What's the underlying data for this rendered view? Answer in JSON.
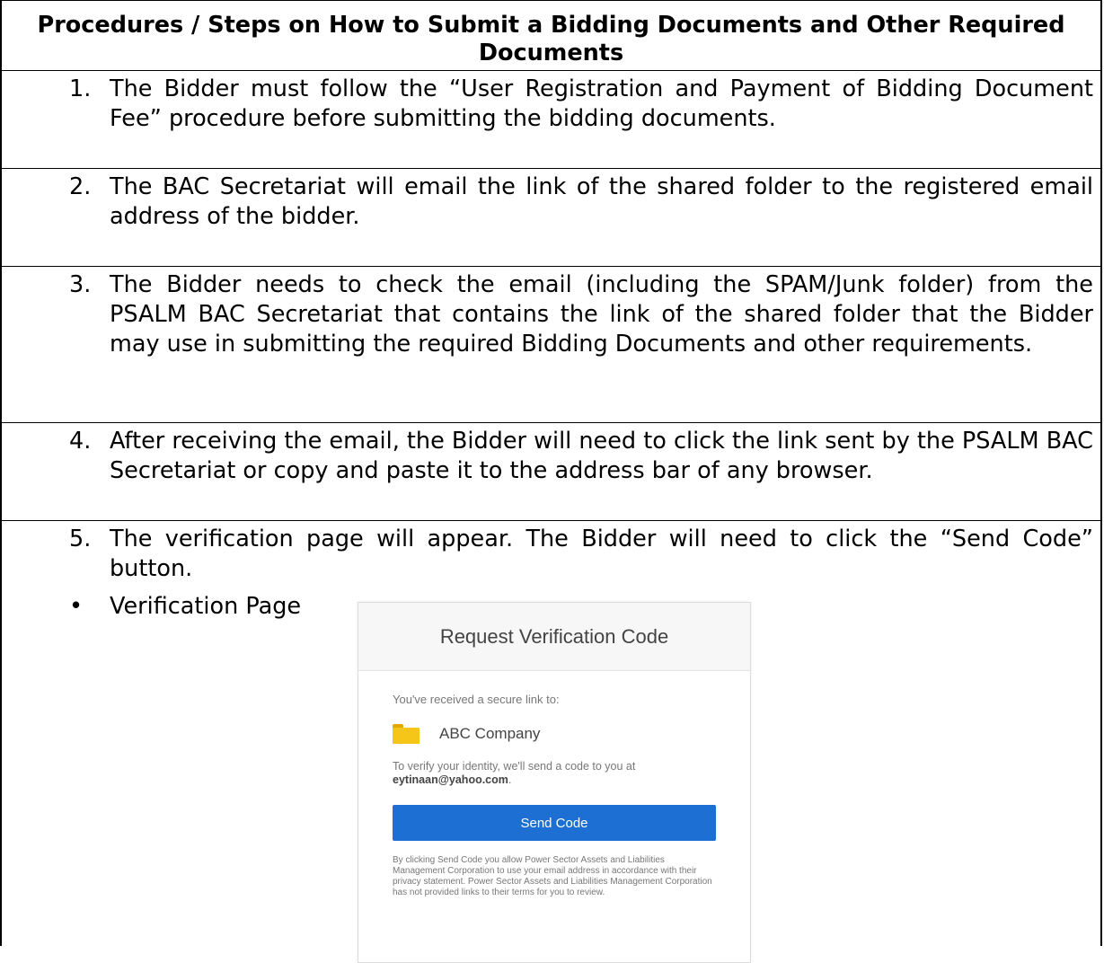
{
  "header": {
    "title": "Procedures / Steps on How to Submit a Bidding Documents and Other Required Documents"
  },
  "steps": [
    {
      "num": "1.",
      "text": "The Bidder must follow the “User Registration and Payment of Bidding Document Fee” procedure before submitting the bidding documents."
    },
    {
      "num": "2.",
      "text": "The BAC Secretariat will email the link of the shared folder to the registered email address of the bidder."
    },
    {
      "num": "3.",
      "text": "The Bidder needs to check the email (including the SPAM/Junk folder) from the PSALM BAC Secretariat that contains the link of the shared folder that the Bidder may use in submitting the required Bidding Documents and other requirements."
    },
    {
      "num": "4.",
      "text": "After receiving the email, the Bidder will need to click the link sent by the PSALM BAC Secretariat or copy and paste it to the address bar of any browser."
    },
    {
      "num": "5.",
      "text": "The verification page will appear. The Bidder will need to click the “Send Code” button."
    }
  ],
  "bullet": {
    "symbol": "•",
    "label": "Verification Page"
  },
  "verification_card": {
    "title": "Request Verification Code",
    "received_text": "You've received a secure link to:",
    "folder_name": "ABC Company",
    "verify_prefix": "To verify your identity, we'll send a code to you at",
    "email": "eytinaan@yahoo.com",
    "verify_suffix": ".",
    "send_button": "Send Code",
    "fine_print": "By clicking Send Code you allow Power Sector Assets and Liabilities Management Corporation to use your email address in accordance with their privacy statement. Power Sector Assets and Liabilities Management Corporation has not provided links to their terms for you to review."
  },
  "colors": {
    "button": "#1d6fd3",
    "folder": "#f5c518"
  }
}
